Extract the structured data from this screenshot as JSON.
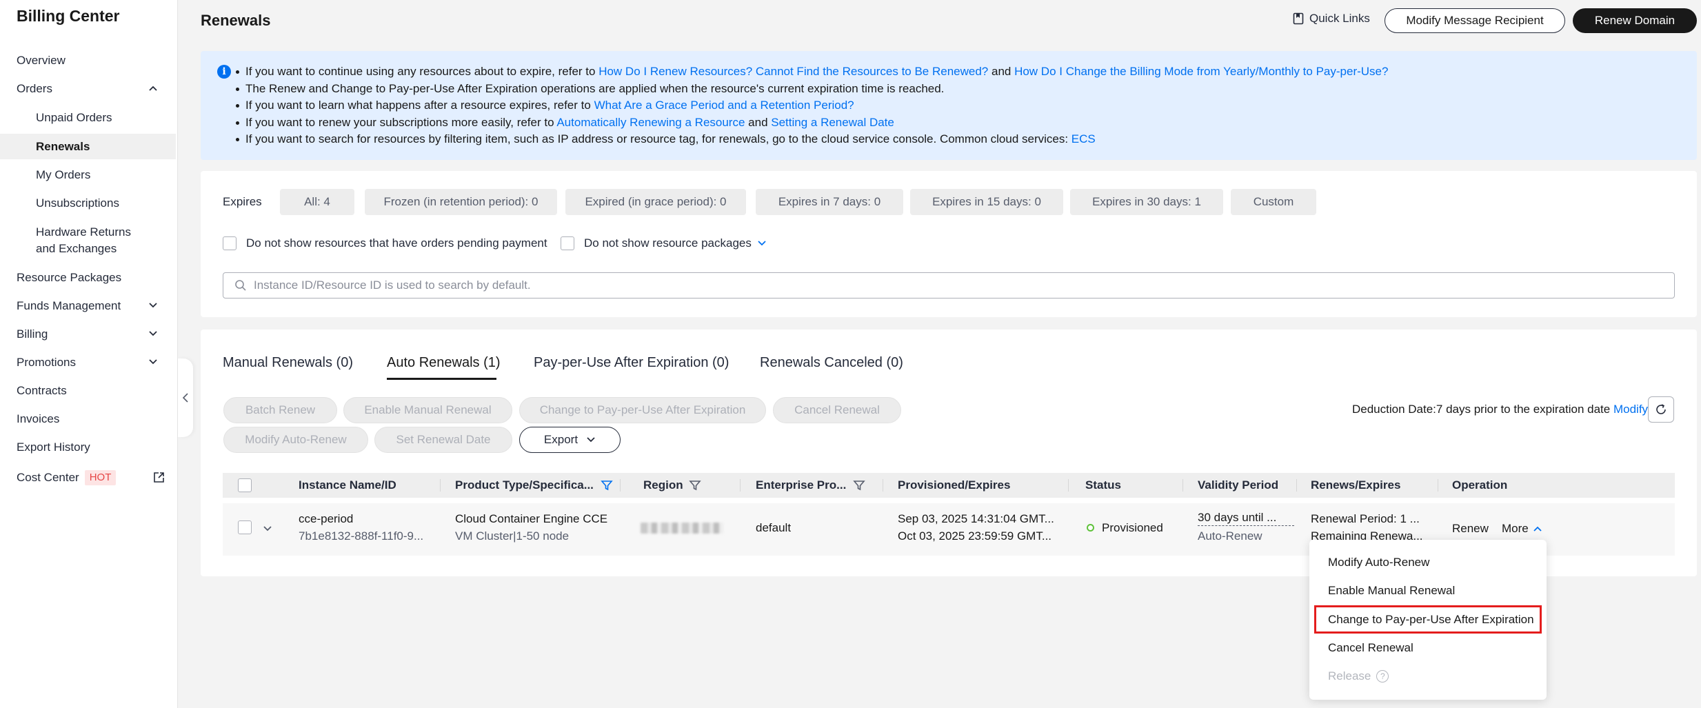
{
  "sidebar": {
    "title": "Billing Center",
    "items": [
      {
        "label": "Overview"
      },
      {
        "label": "Orders"
      },
      {
        "label": "Unpaid Orders"
      },
      {
        "label": "Renewals"
      },
      {
        "label": "My Orders"
      },
      {
        "label": "Unsubscriptions"
      },
      {
        "label": "Hardware Returns and Exchanges"
      },
      {
        "label": "Resource Packages"
      },
      {
        "label": "Funds Management"
      },
      {
        "label": "Billing"
      },
      {
        "label": "Promotions"
      },
      {
        "label": "Contracts"
      },
      {
        "label": "Invoices"
      },
      {
        "label": "Export History"
      },
      {
        "label": "Cost Center",
        "badge": "HOT"
      }
    ]
  },
  "header": {
    "title": "Renewals",
    "quick_links": "Quick Links",
    "modify_recipient": "Modify Message Recipient",
    "renew_domain": "Renew Domain"
  },
  "info": {
    "l1_a": "If you want to continue using any resources about to expire, refer to ",
    "l1_link1": "How Do I Renew Resources? Cannot Find the Resources to Be Renewed?",
    "l1_b": " and ",
    "l1_link2": "How Do I Change the Billing Mode from Yearly/Monthly to Pay-per-Use?",
    "l2": "The Renew and Change to Pay-per-Use After Expiration operations are applied when the resource's current expiration time is reached.",
    "l3_a": "If you want to learn what happens after a resource expires, refer to ",
    "l3_link": "What Are a Grace Period and a Retention Period?",
    "l4_a": "If you want to renew your subscriptions more easily, refer to ",
    "l4_link1": "Automatically Renewing a Resource",
    "l4_b": " and ",
    "l4_link2": "Setting a Renewal Date",
    "l5_a": "If you want to search for resources by filtering item, such as IP address or resource tag, for renewals, go to the cloud service console. Common cloud services: ",
    "l5_link": "ECS"
  },
  "filters": {
    "expires_label": "Expires",
    "chips": [
      "All: 4",
      "Frozen (in retention period): 0",
      "Expired (in grace period): 0",
      "Expires in 7 days: 0",
      "Expires in 15 days: 0",
      "Expires in 30 days: 1",
      "Custom"
    ],
    "cb_pending": "Do not show resources that have orders pending payment",
    "cb_packages": "Do not show resource packages",
    "search_placeholder": "Instance ID/Resource ID is used to search by default."
  },
  "tabs": [
    "Manual Renewals (0)",
    "Auto Renewals (1)",
    "Pay-per-Use After Expiration (0)",
    "Renewals Canceled (0)"
  ],
  "actions": {
    "batch_renew": "Batch Renew",
    "enable_manual": "Enable Manual Renewal",
    "change_ppu": "Change to Pay-per-Use After Expiration",
    "cancel_renewal": "Cancel Renewal",
    "modify_auto": "Modify Auto-Renew",
    "set_date": "Set Renewal Date",
    "export": "Export",
    "deduction": "Deduction Date:7 days prior to the expiration date",
    "modify": "Modify"
  },
  "table": {
    "headers": [
      "Instance Name/ID",
      "Product Type/Specifica...",
      "Region",
      "Enterprise Pro...",
      "Provisioned/Expires",
      "Status",
      "Validity Period",
      "Renews/Expires",
      "Operation"
    ],
    "row": {
      "name": "cce-period",
      "id": "7b1e8132-888f-11f0-9...",
      "product": "Cloud Container Engine CCE",
      "spec": "VM Cluster|1-50 node",
      "enterprise": "default",
      "provisioned": "Sep 03, 2025 14:31:04 GMT...",
      "expires": "Oct 03, 2025 23:59:59 GMT...",
      "status": "Provisioned",
      "validity": "30 days until ...",
      "validity_sub": "Auto-Renew",
      "renew_period": "Renewal Period: 1 ...",
      "remaining": "Remaining Renewa...",
      "op_renew": "Renew",
      "op_more": "More"
    }
  },
  "dropdown": {
    "items": [
      "Modify Auto-Renew",
      "Enable Manual Renewal",
      "Change to Pay-per-Use After Expiration",
      "Cancel Renewal",
      "Release"
    ]
  },
  "colors": {
    "link": "#0070f0",
    "highlight": "#e41d1d",
    "status_ok": "#5ec23a"
  }
}
